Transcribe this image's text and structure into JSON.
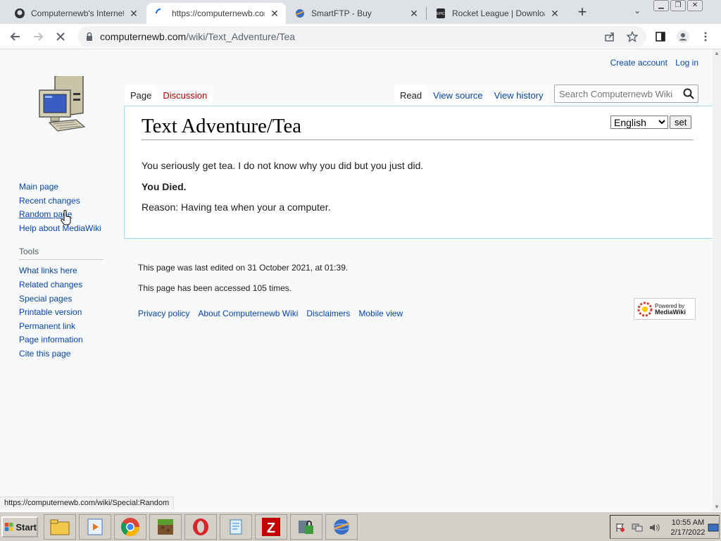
{
  "browser": {
    "tabs": [
      {
        "title": "Computernewb's Internet P",
        "active": false
      },
      {
        "title": "https://computernewb.com",
        "active": true
      },
      {
        "title": "SmartFTP - Buy",
        "active": false
      },
      {
        "title": "Rocket League | Download",
        "active": false
      }
    ],
    "url_domain": "computernewb.com",
    "url_path": "/wiki/Text_Adventure/Tea",
    "status_url": "https://computernewb.com/wiki/Special:Random"
  },
  "wiki": {
    "personal": {
      "create_account": "Create account",
      "log_in": "Log in"
    },
    "nav_items": [
      "Main page",
      "Recent changes",
      "Random page",
      "Help about MediaWiki"
    ],
    "tools_heading": "Tools",
    "tools_items": [
      "What links here",
      "Related changes",
      "Special pages",
      "Printable version",
      "Permanent link",
      "Page information",
      "Cite this page"
    ],
    "namespace_tabs": {
      "page": "Page",
      "discussion": "Discussion"
    },
    "view_tabs": {
      "read": "Read",
      "view_source": "View source",
      "view_history": "View history"
    },
    "search_placeholder": "Search Computernewb Wiki",
    "language": {
      "selected": "English",
      "set_label": "set"
    },
    "title": "Text Adventure/Tea",
    "paragraphs": [
      "You seriously get tea. I do not know why you did but you just did.",
      "You Died.",
      "Reason: Having tea when your a computer."
    ],
    "footer": {
      "last_edited": "This page was last edited on 31 October 2021, at 01:39.",
      "accessed": "This page has been accessed 105 times.",
      "links": [
        "Privacy policy",
        "About Computernewb Wiki",
        "Disclaimers",
        "Mobile view"
      ],
      "powered_by_line1": "Powered by",
      "powered_by_line2": "MediaWiki"
    }
  },
  "taskbar": {
    "start_label": "Start",
    "time": "10:55 AM",
    "date": "2/17/2022"
  },
  "colors": {
    "link": "#0645ad",
    "new_link": "#ba0000",
    "tab_border": "#a7d7f9"
  }
}
